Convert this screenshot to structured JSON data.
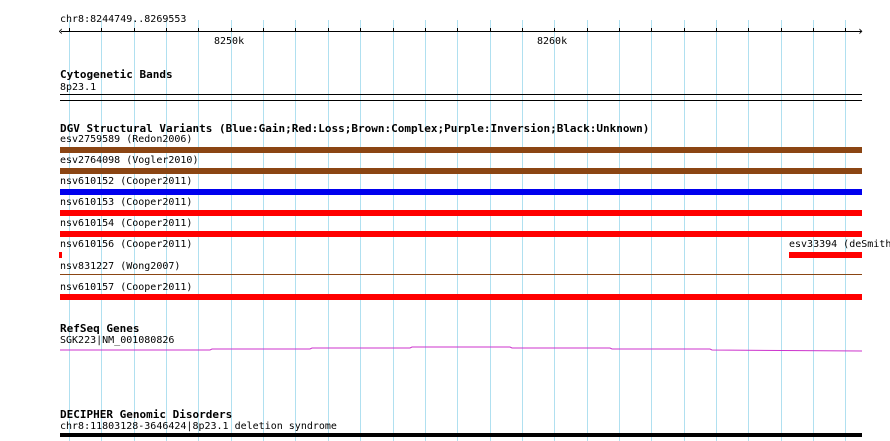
{
  "ruler": {
    "location": "chr8:8244749..8269553",
    "ticks": [
      "8250k",
      "8260k"
    ]
  },
  "colors": {
    "gain": "#0000ee",
    "loss": "#ff0000",
    "complex": "#8b4513",
    "gene": "#cc33cc",
    "grid": "#b0e0f0"
  },
  "tracks": {
    "cytobands": {
      "title": "Cytogenetic Bands",
      "band": "8p23.1"
    },
    "dgv": {
      "title": "DGV Structural Variants (Blue:Gain;Red:Loss;Brown:Complex;Purple:Inversion;Black:Unknown)",
      "variants": [
        {
          "label": "esv2759589 (Redon2006)",
          "type": "complex"
        },
        {
          "label": "esv2764098 (Vogler2010)",
          "type": "complex"
        },
        {
          "label": "nsv610152 (Cooper2011)",
          "type": "gain"
        },
        {
          "label": "nsv610153 (Cooper2011)",
          "type": "loss"
        },
        {
          "label": "nsv610154 (Cooper2011)",
          "type": "loss"
        },
        {
          "label": "nsv610156 (Cooper2011)",
          "type": "loss"
        },
        {
          "label": "esv33394 (deSmith",
          "type": "loss"
        },
        {
          "label": "nsv831227 (Wong2007)",
          "type": "complex"
        },
        {
          "label": "nsv610157 (Cooper2011)",
          "type": "loss"
        }
      ]
    },
    "refseq": {
      "title": "RefSeq Genes",
      "gene": "SGK223|NM_001080826"
    },
    "decipher": {
      "title": "DECIPHER Genomic Disorders",
      "feature": "chr8:11803128-3646424|8p23.1 deletion syndrome"
    }
  }
}
